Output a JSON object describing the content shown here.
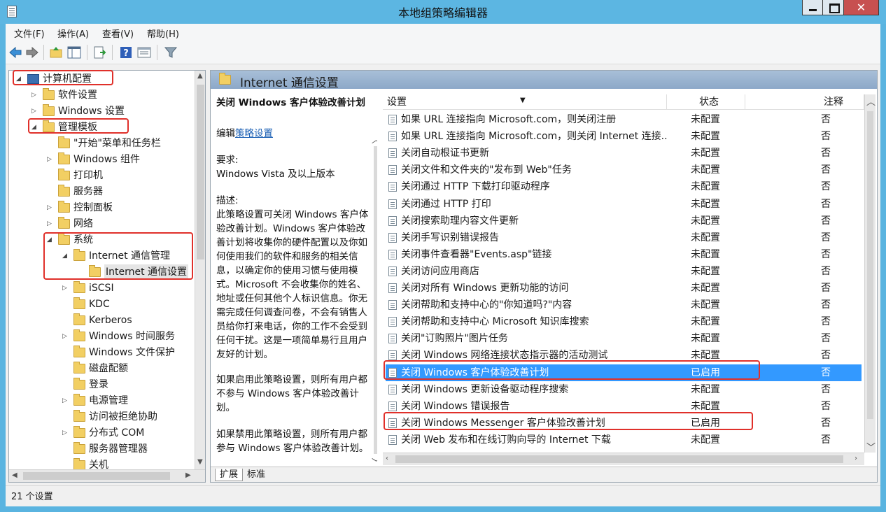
{
  "window": {
    "title": "本地组策略编辑器"
  },
  "menu": [
    "文件(F)",
    "操作(A)",
    "查看(V)",
    "帮助(H)"
  ],
  "toolbar": {
    "icons": [
      "back-arrow-icon",
      "forward-arrow-icon",
      "folder-up-icon",
      "show-hide-tree-icon",
      "export-list-icon",
      "help-icon",
      "properties-icon",
      "filter-icon"
    ]
  },
  "tree": {
    "items": [
      {
        "label": "计算机配置",
        "icon": "computer-icon"
      },
      {
        "label": "软件设置",
        "icon": "folder-icon"
      },
      {
        "label": "Windows 设置",
        "icon": "folder-icon"
      },
      {
        "label": "管理模板",
        "icon": "folder-icon"
      },
      {
        "label": "\"开始\"菜单和任务栏",
        "icon": "folder-icon"
      },
      {
        "label": "Windows 组件",
        "icon": "folder-icon"
      },
      {
        "label": "打印机",
        "icon": "folder-icon"
      },
      {
        "label": "服务器",
        "icon": "folder-icon"
      },
      {
        "label": "控制面板",
        "icon": "folder-icon"
      },
      {
        "label": "网络",
        "icon": "folder-icon"
      },
      {
        "label": "系统",
        "icon": "folder-icon"
      },
      {
        "label": "Internet 通信管理",
        "icon": "folder-icon"
      },
      {
        "label": "Internet 通信设置",
        "icon": "folder-icon"
      },
      {
        "label": "iSCSI",
        "icon": "folder-icon"
      },
      {
        "label": "KDC",
        "icon": "folder-icon"
      },
      {
        "label": "Kerberos",
        "icon": "folder-icon"
      },
      {
        "label": "Windows 时间服务",
        "icon": "folder-icon"
      },
      {
        "label": "Windows 文件保护",
        "icon": "folder-icon"
      },
      {
        "label": "磁盘配额",
        "icon": "folder-icon"
      },
      {
        "label": "登录",
        "icon": "folder-icon"
      },
      {
        "label": "电源管理",
        "icon": "folder-icon"
      },
      {
        "label": "访问被拒绝协助",
        "icon": "folder-icon"
      },
      {
        "label": "分布式 COM",
        "icon": "folder-icon"
      },
      {
        "label": "服务器管理器",
        "icon": "folder-icon"
      },
      {
        "label": "关机",
        "icon": "folder-icon"
      }
    ]
  },
  "right": {
    "header_title": "Internet 通信设置",
    "description": {
      "title": "关闭 Windows 客户体验改善计划",
      "edit_prefix": "编辑",
      "edit_link": "策略设置",
      "req_label": "要求:",
      "req_value": "Windows Vista 及以上版本",
      "desc_label": "描述:",
      "desc_body": "此策略设置可关闭 Windows 客户体验改善计划。Windows 客户体验改善计划将收集你的硬件配置以及你如何使用我们的软件和服务的相关信息，以确定你的使用习惯与使用模式。Microsoft 不会收集你的姓名、地址或任何其他个人标识信息。你无需完成任何调查问卷，不会有销售人员给你打来电话，你的工作不会受到任何干扰。这是一项简单易行且用户友好的计划。",
      "enabled_text": "如果启用此策略设置，则所有用户都不参与 Windows 客户体验改善计划。",
      "disabled_text": "如果禁用此策略设置，则所有用户都参与 Windows 客户体验改善计划。"
    },
    "columns": {
      "setting": "设置",
      "state": "状态",
      "note": "注释"
    },
    "rows": [
      {
        "setting": "如果 URL 连接指向 Microsoft.com，则关闭注册",
        "state": "未配置",
        "note": "否"
      },
      {
        "setting": "如果 URL 连接指向 Microsoft.com，则关闭 Internet 连接...",
        "state": "未配置",
        "note": "否"
      },
      {
        "setting": "关闭自动根证书更新",
        "state": "未配置",
        "note": "否"
      },
      {
        "setting": "关闭文件和文件夹的\"发布到 Web\"任务",
        "state": "未配置",
        "note": "否"
      },
      {
        "setting": "关闭通过 HTTP 下载打印驱动程序",
        "state": "未配置",
        "note": "否"
      },
      {
        "setting": "关闭通过 HTTP 打印",
        "state": "未配置",
        "note": "否"
      },
      {
        "setting": "关闭搜索助理内容文件更新",
        "state": "未配置",
        "note": "否"
      },
      {
        "setting": "关闭手写识别错误报告",
        "state": "未配置",
        "note": "否"
      },
      {
        "setting": "关闭事件查看器\"Events.asp\"链接",
        "state": "未配置",
        "note": "否"
      },
      {
        "setting": "关闭访问应用商店",
        "state": "未配置",
        "note": "否"
      },
      {
        "setting": "关闭对所有 Windows 更新功能的访问",
        "state": "未配置",
        "note": "否"
      },
      {
        "setting": "关闭帮助和支持中心的\"你知道吗?\"内容",
        "state": "未配置",
        "note": "否"
      },
      {
        "setting": "关闭帮助和支持中心 Microsoft 知识库搜索",
        "state": "未配置",
        "note": "否"
      },
      {
        "setting": "关闭\"订购照片\"图片任务",
        "state": "未配置",
        "note": "否"
      },
      {
        "setting": "关闭 Windows 网络连接状态指示器的活动测试",
        "state": "未配置",
        "note": "否"
      },
      {
        "setting": "关闭 Windows 客户体验改善计划",
        "state": "已启用",
        "note": "否"
      },
      {
        "setting": "关闭 Windows 更新设备驱动程序搜索",
        "state": "未配置",
        "note": "否"
      },
      {
        "setting": "关闭 Windows 错误报告",
        "state": "未配置",
        "note": "否"
      },
      {
        "setting": "关闭 Windows Messenger 客户体验改善计划",
        "state": "已启用",
        "note": "否"
      },
      {
        "setting": "关闭 Web 发布和在线订购向导的 Internet 下载",
        "state": "未配置",
        "note": "否"
      }
    ],
    "tabs": [
      "扩展",
      "标准"
    ]
  },
  "status": {
    "text": "21 个设置"
  },
  "colors": {
    "titlebar": "#5cb6e2",
    "selection": "#3399ff",
    "highlight_box": "#e0302a",
    "close_button": "#c75050"
  }
}
